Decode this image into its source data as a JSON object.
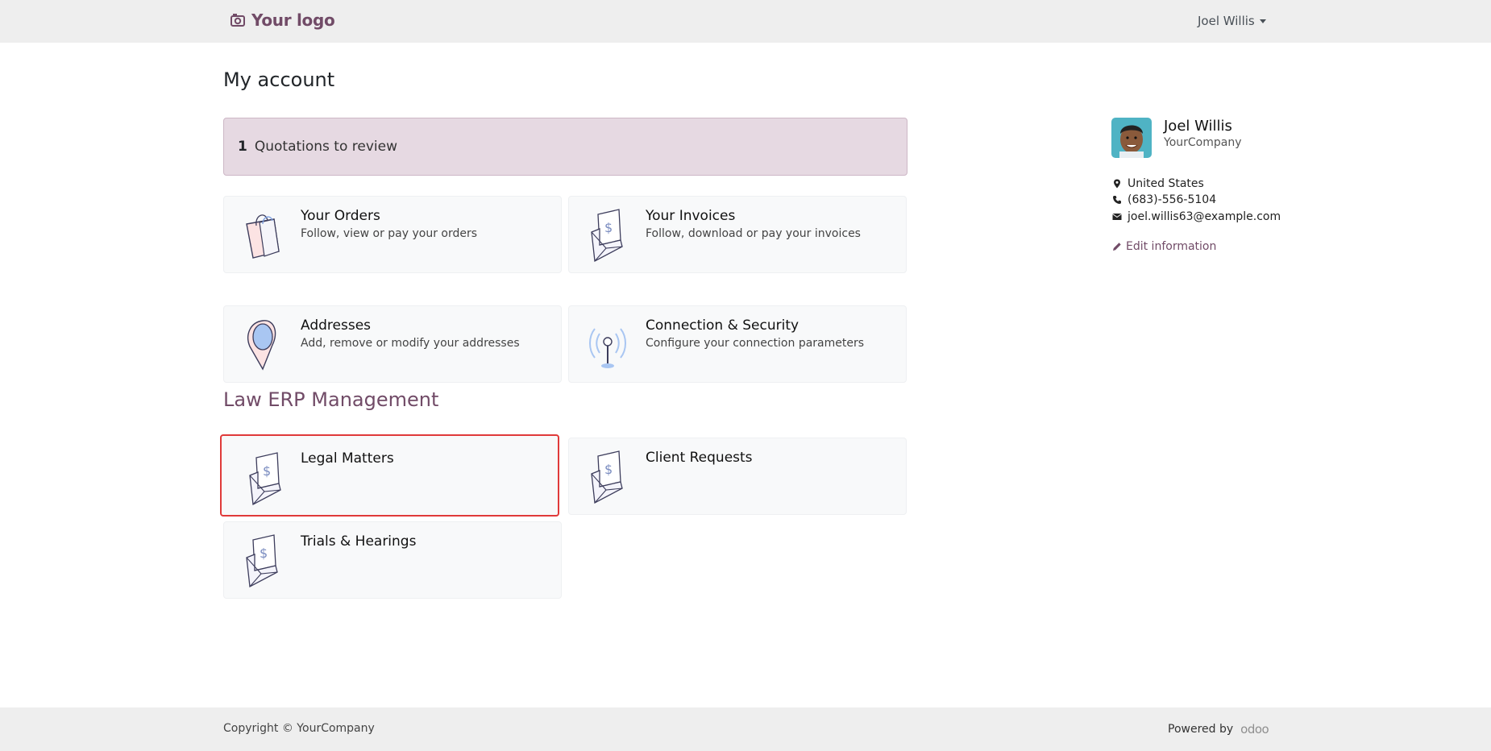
{
  "header": {
    "logo_text": "Your logo",
    "user_name": "Joel Willis"
  },
  "page": {
    "title": "My account",
    "alert": {
      "count": "1",
      "text": "Quotations to review"
    },
    "cards": [
      {
        "title": "Your Orders",
        "desc": "Follow, view or pay your orders",
        "icon": "shopping-bag-icon"
      },
      {
        "title": "Your Invoices",
        "desc": "Follow, download or pay your invoices",
        "icon": "invoice-envelope-icon"
      },
      {
        "title": "Addresses",
        "desc": "Add, remove or modify your addresses",
        "icon": "map-pin-icon"
      },
      {
        "title": "Connection & Security",
        "desc": "Configure your connection parameters",
        "icon": "antenna-icon"
      }
    ],
    "section_title": "Law ERP Management",
    "law_cards": [
      {
        "title": "Legal Matters",
        "selected": true
      },
      {
        "title": "Client Requests",
        "selected": false
      },
      {
        "title": "Trials & Hearings",
        "selected": false
      }
    ]
  },
  "profile": {
    "name": "Joel Willis",
    "company": "YourCompany",
    "country": "United States",
    "phone": "(683)-556-5104",
    "email": "joel.willis63@example.com",
    "edit_label": "Edit information"
  },
  "footer": {
    "copyright": "Copyright © YourCompany",
    "powered_by": "Powered by",
    "brand": "odoo"
  },
  "colors": {
    "brand": "#714b67",
    "alert_bg": "#e6d9e2",
    "selection_border": "#e03a3a",
    "card_bg": "#f8f9fa",
    "topbar_bg": "#eeeeee"
  }
}
